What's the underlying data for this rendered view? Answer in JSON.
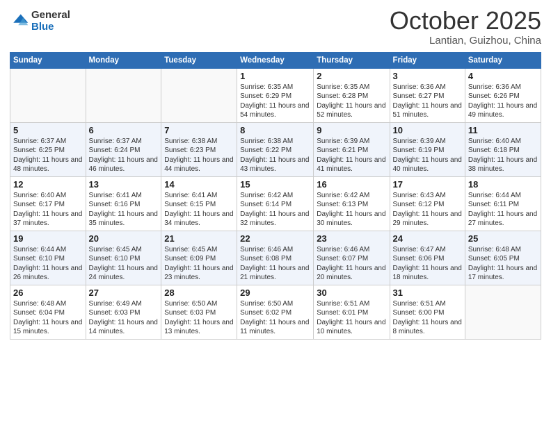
{
  "header": {
    "logo_general": "General",
    "logo_blue": "Blue",
    "month_title": "October 2025",
    "location": "Lantian, Guizhou, China"
  },
  "days_of_week": [
    "Sunday",
    "Monday",
    "Tuesday",
    "Wednesday",
    "Thursday",
    "Friday",
    "Saturday"
  ],
  "weeks": [
    [
      {
        "num": "",
        "info": ""
      },
      {
        "num": "",
        "info": ""
      },
      {
        "num": "",
        "info": ""
      },
      {
        "num": "1",
        "info": "Sunrise: 6:35 AM\nSunset: 6:29 PM\nDaylight: 11 hours and 54 minutes."
      },
      {
        "num": "2",
        "info": "Sunrise: 6:35 AM\nSunset: 6:28 PM\nDaylight: 11 hours and 52 minutes."
      },
      {
        "num": "3",
        "info": "Sunrise: 6:36 AM\nSunset: 6:27 PM\nDaylight: 11 hours and 51 minutes."
      },
      {
        "num": "4",
        "info": "Sunrise: 6:36 AM\nSunset: 6:26 PM\nDaylight: 11 hours and 49 minutes."
      }
    ],
    [
      {
        "num": "5",
        "info": "Sunrise: 6:37 AM\nSunset: 6:25 PM\nDaylight: 11 hours and 48 minutes."
      },
      {
        "num": "6",
        "info": "Sunrise: 6:37 AM\nSunset: 6:24 PM\nDaylight: 11 hours and 46 minutes."
      },
      {
        "num": "7",
        "info": "Sunrise: 6:38 AM\nSunset: 6:23 PM\nDaylight: 11 hours and 44 minutes."
      },
      {
        "num": "8",
        "info": "Sunrise: 6:38 AM\nSunset: 6:22 PM\nDaylight: 11 hours and 43 minutes."
      },
      {
        "num": "9",
        "info": "Sunrise: 6:39 AM\nSunset: 6:21 PM\nDaylight: 11 hours and 41 minutes."
      },
      {
        "num": "10",
        "info": "Sunrise: 6:39 AM\nSunset: 6:19 PM\nDaylight: 11 hours and 40 minutes."
      },
      {
        "num": "11",
        "info": "Sunrise: 6:40 AM\nSunset: 6:18 PM\nDaylight: 11 hours and 38 minutes."
      }
    ],
    [
      {
        "num": "12",
        "info": "Sunrise: 6:40 AM\nSunset: 6:17 PM\nDaylight: 11 hours and 37 minutes."
      },
      {
        "num": "13",
        "info": "Sunrise: 6:41 AM\nSunset: 6:16 PM\nDaylight: 11 hours and 35 minutes."
      },
      {
        "num": "14",
        "info": "Sunrise: 6:41 AM\nSunset: 6:15 PM\nDaylight: 11 hours and 34 minutes."
      },
      {
        "num": "15",
        "info": "Sunrise: 6:42 AM\nSunset: 6:14 PM\nDaylight: 11 hours and 32 minutes."
      },
      {
        "num": "16",
        "info": "Sunrise: 6:42 AM\nSunset: 6:13 PM\nDaylight: 11 hours and 30 minutes."
      },
      {
        "num": "17",
        "info": "Sunrise: 6:43 AM\nSunset: 6:12 PM\nDaylight: 11 hours and 29 minutes."
      },
      {
        "num": "18",
        "info": "Sunrise: 6:44 AM\nSunset: 6:11 PM\nDaylight: 11 hours and 27 minutes."
      }
    ],
    [
      {
        "num": "19",
        "info": "Sunrise: 6:44 AM\nSunset: 6:10 PM\nDaylight: 11 hours and 26 minutes."
      },
      {
        "num": "20",
        "info": "Sunrise: 6:45 AM\nSunset: 6:10 PM\nDaylight: 11 hours and 24 minutes."
      },
      {
        "num": "21",
        "info": "Sunrise: 6:45 AM\nSunset: 6:09 PM\nDaylight: 11 hours and 23 minutes."
      },
      {
        "num": "22",
        "info": "Sunrise: 6:46 AM\nSunset: 6:08 PM\nDaylight: 11 hours and 21 minutes."
      },
      {
        "num": "23",
        "info": "Sunrise: 6:46 AM\nSunset: 6:07 PM\nDaylight: 11 hours and 20 minutes."
      },
      {
        "num": "24",
        "info": "Sunrise: 6:47 AM\nSunset: 6:06 PM\nDaylight: 11 hours and 18 minutes."
      },
      {
        "num": "25",
        "info": "Sunrise: 6:48 AM\nSunset: 6:05 PM\nDaylight: 11 hours and 17 minutes."
      }
    ],
    [
      {
        "num": "26",
        "info": "Sunrise: 6:48 AM\nSunset: 6:04 PM\nDaylight: 11 hours and 15 minutes."
      },
      {
        "num": "27",
        "info": "Sunrise: 6:49 AM\nSunset: 6:03 PM\nDaylight: 11 hours and 14 minutes."
      },
      {
        "num": "28",
        "info": "Sunrise: 6:50 AM\nSunset: 6:03 PM\nDaylight: 11 hours and 13 minutes."
      },
      {
        "num": "29",
        "info": "Sunrise: 6:50 AM\nSunset: 6:02 PM\nDaylight: 11 hours and 11 minutes."
      },
      {
        "num": "30",
        "info": "Sunrise: 6:51 AM\nSunset: 6:01 PM\nDaylight: 11 hours and 10 minutes."
      },
      {
        "num": "31",
        "info": "Sunrise: 6:51 AM\nSunset: 6:00 PM\nDaylight: 11 hours and 8 minutes."
      },
      {
        "num": "",
        "info": ""
      }
    ]
  ]
}
